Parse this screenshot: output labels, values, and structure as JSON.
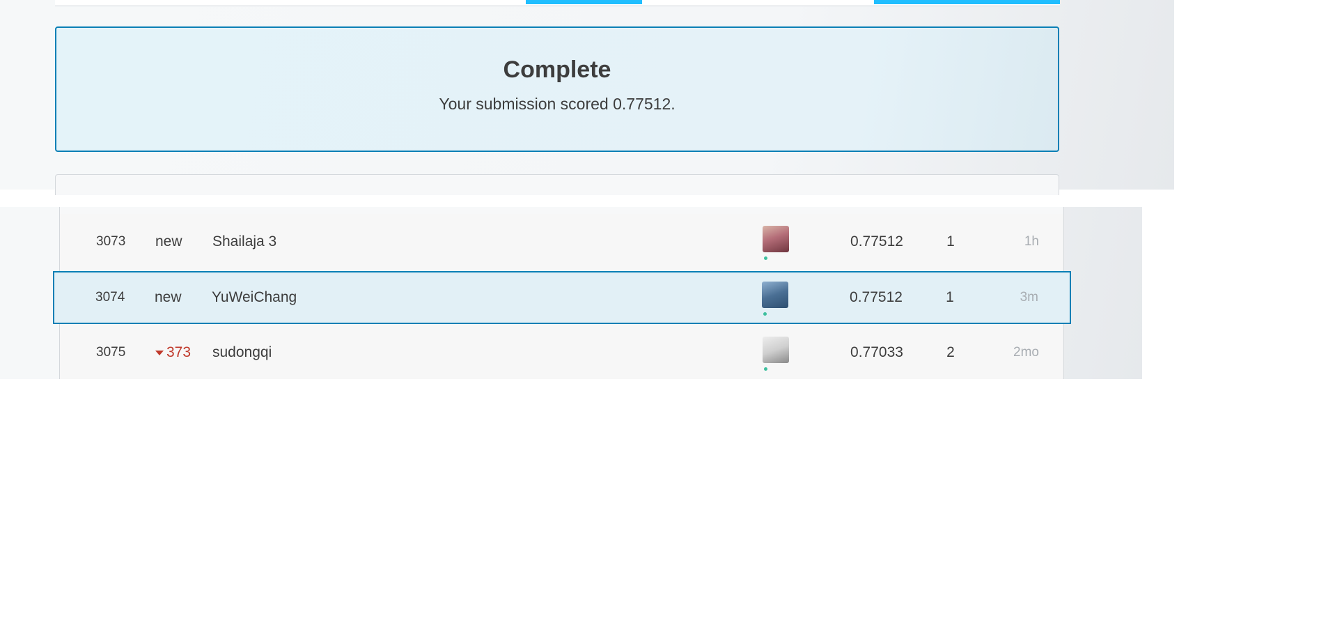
{
  "submission": {
    "status_title": "Complete",
    "score_message": "Your submission scored 0.77512."
  },
  "leaderboard": {
    "rows": [
      {
        "rank": "3073",
        "delta": "new",
        "team": "Shailaja 3",
        "score": "0.77512",
        "entries": "1",
        "last": "1h",
        "highlighted": false
      },
      {
        "rank": "3074",
        "delta": "new",
        "team": "YuWeiChang",
        "score": "0.77512",
        "entries": "1",
        "last": "3m",
        "highlighted": true
      },
      {
        "rank": "3075",
        "delta": "373",
        "delta_direction": "down",
        "team": "sudongqi",
        "score": "0.77033",
        "entries": "2",
        "last": "2mo",
        "highlighted": false
      }
    ]
  },
  "colors": {
    "accent": "#20beff",
    "highlight_border": "#0a7fb5",
    "rank_down": "#c0392b",
    "online": "#3dbf9e"
  },
  "icons": {
    "rank_down": "caret-down-icon",
    "online": "online-status-dot"
  }
}
